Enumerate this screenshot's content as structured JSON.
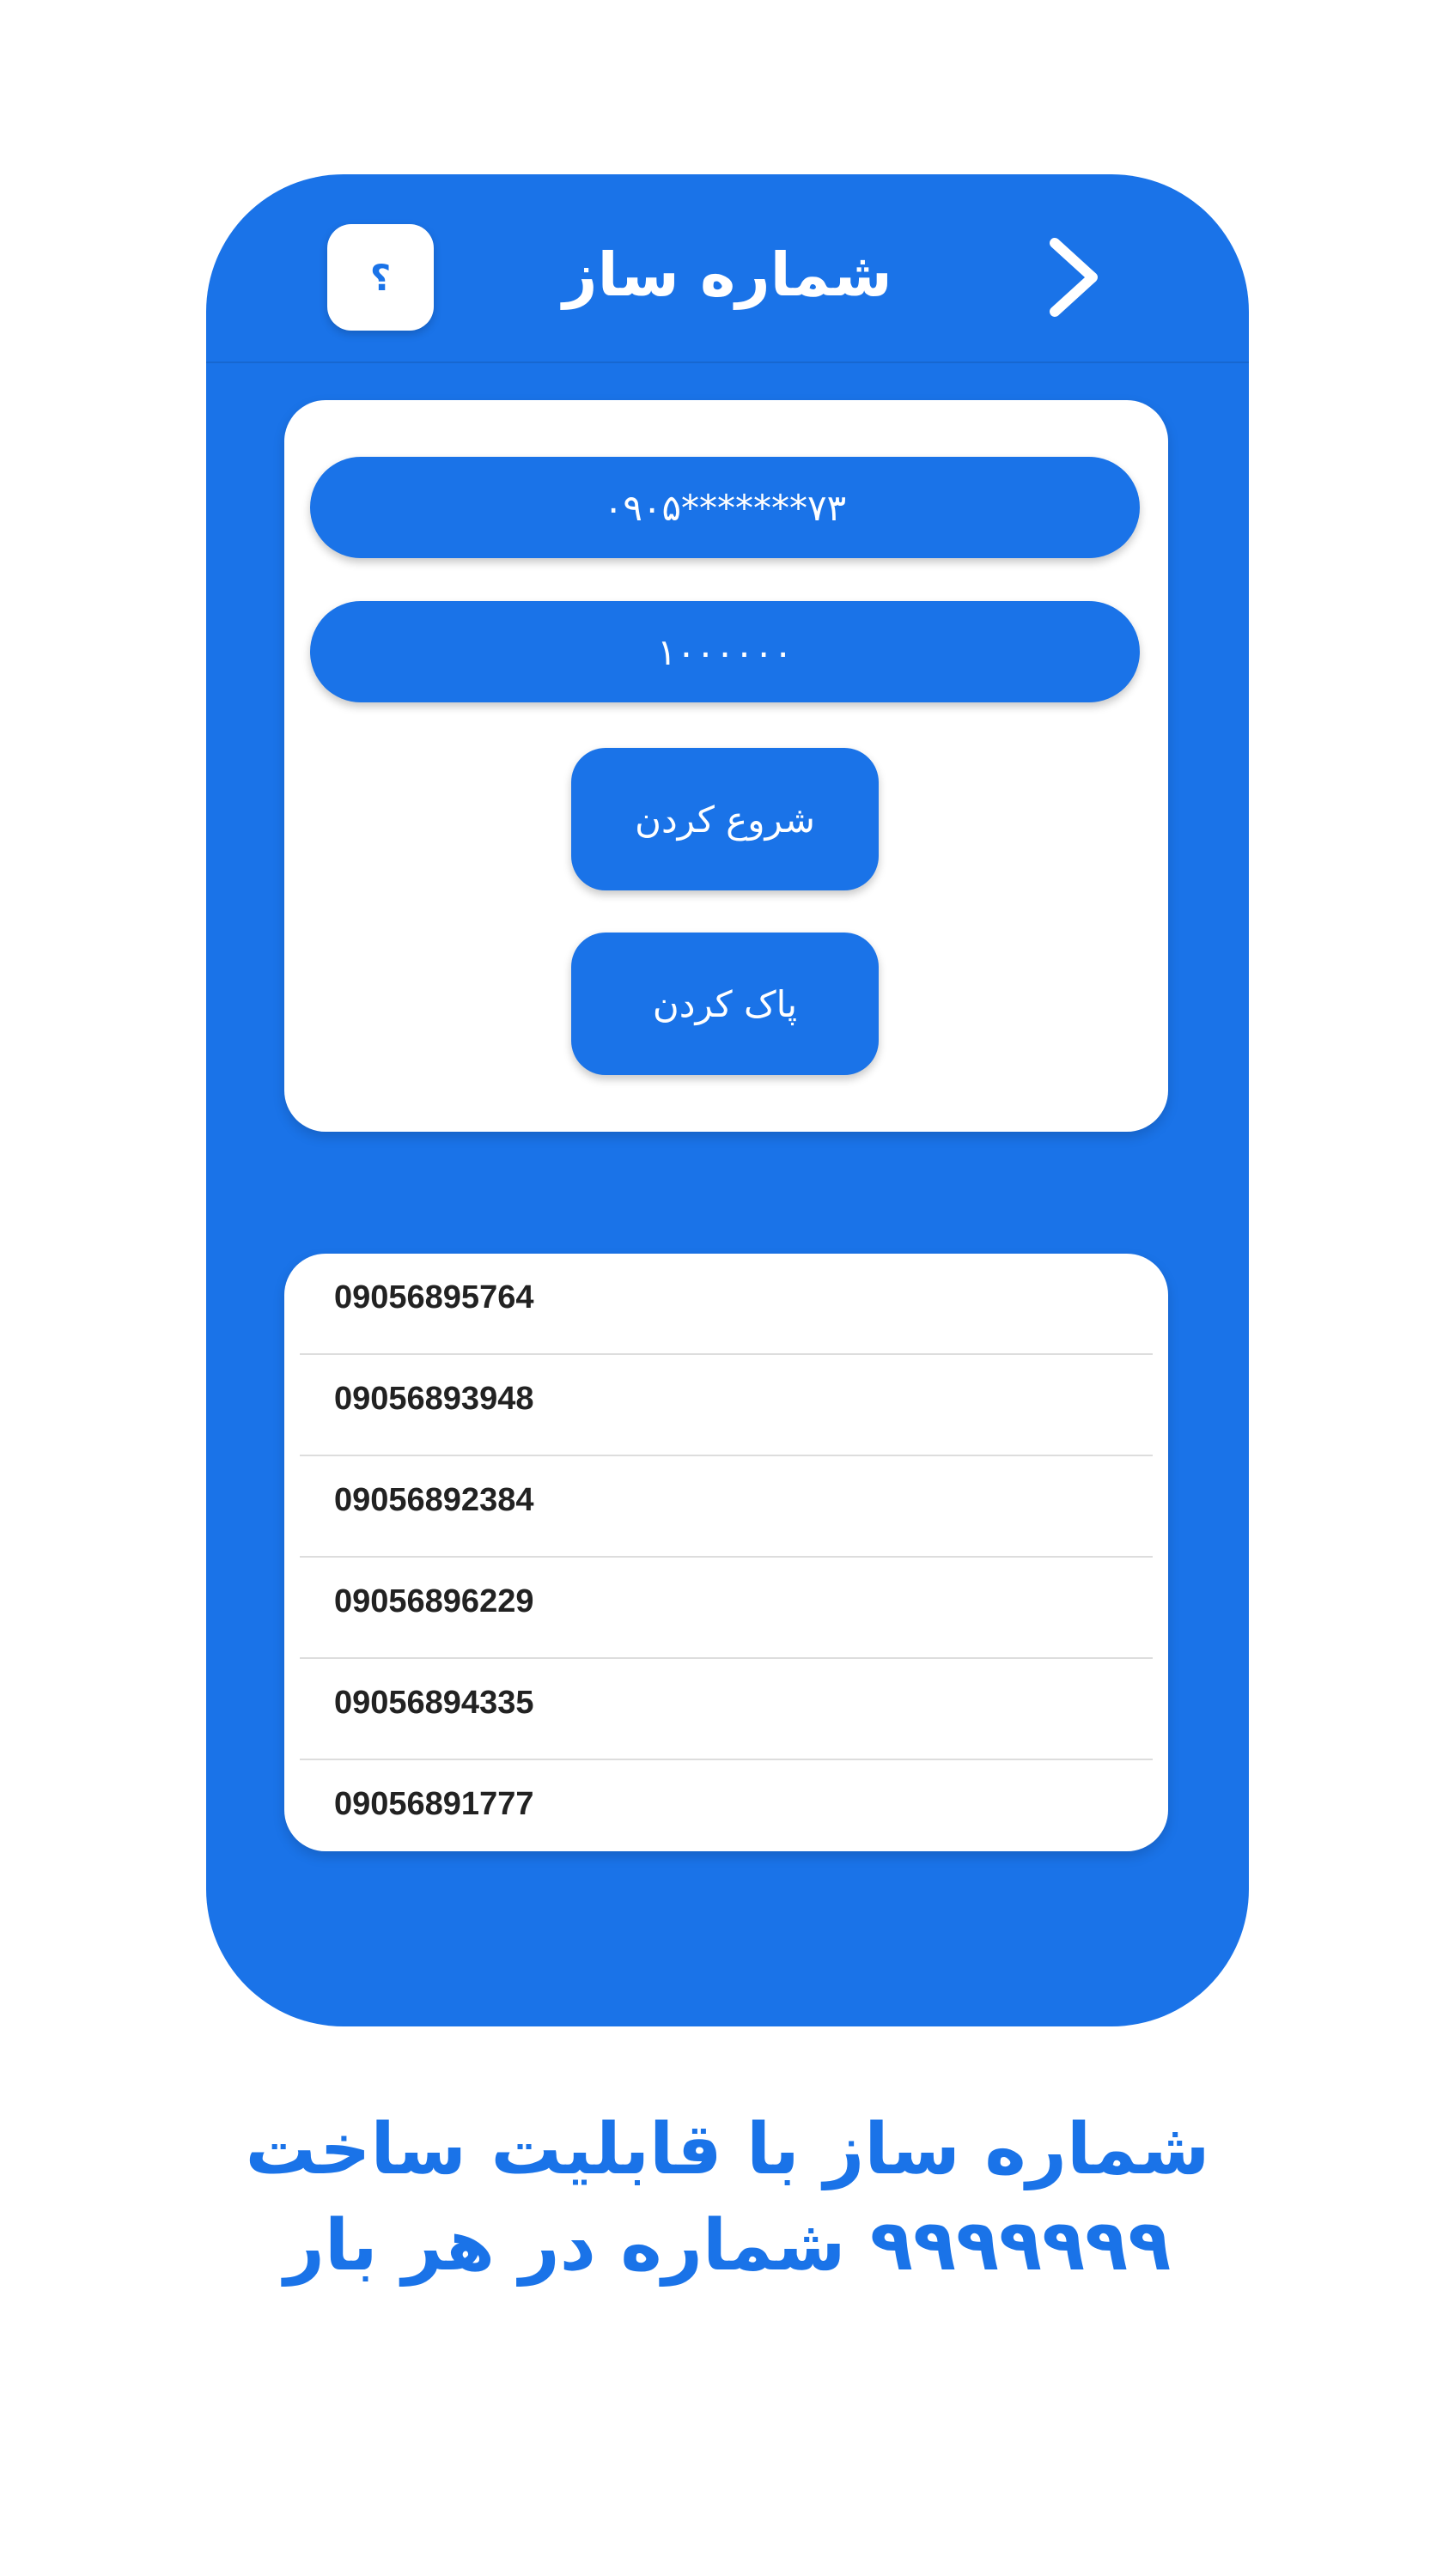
{
  "appbar": {
    "title": "شماره ساز",
    "help_label": "؟"
  },
  "form": {
    "pattern_field": "۰۹۰۵*******۷۳",
    "count_field": "۱۰۰۰۰۰۰",
    "start_label": "شروع کردن",
    "clear_label": "پاک کردن"
  },
  "results": [
    "09056895764",
    "09056893948",
    "09056892384",
    "09056896229",
    "09056894335",
    "09056891777"
  ],
  "promo": {
    "line1": "شماره ساز با قابلیت ساخت",
    "line2": "۹۹۹۹۹۹۹ شماره در هر بار"
  },
  "colors": {
    "primary": "#1a73e8",
    "surface": "#ffffff"
  },
  "icons": {
    "help": "help-icon",
    "back": "chevron-right-icon"
  }
}
